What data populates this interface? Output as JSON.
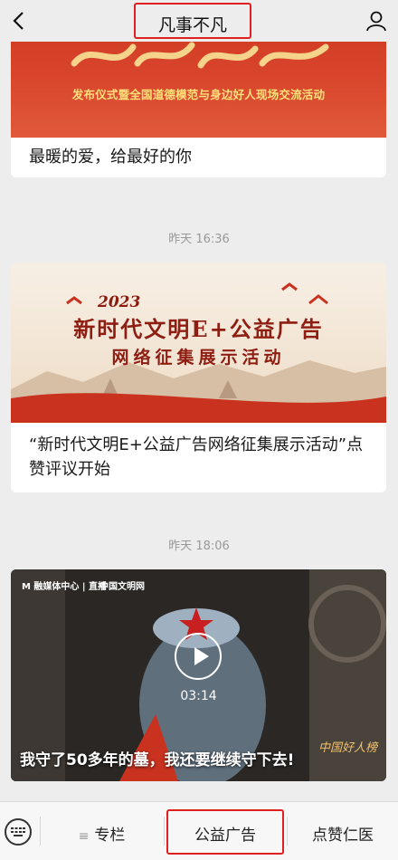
{
  "header": {
    "title": "凡事不凡",
    "back_icon": "chevron-left-icon",
    "profile_icon": "person-icon"
  },
  "feed": {
    "card1": {
      "image_subtitle": "发布仪式暨全国道德模范与身边好人现场交流活动",
      "text": "最暖的爱，给最好的你"
    },
    "time1": "昨天 16:36",
    "card2": {
      "image_year": "2023",
      "image_line1": "新时代文明E+公益广告",
      "image_line2": "网络征集展示活动",
      "text": "“新时代文明E+公益广告网络征集展示活动”点赞评议开始"
    },
    "time2": "昨天 18:06",
    "card3": {
      "duration": "03:14",
      "caption": "我守了50多年的墓，我还要继续守下去!",
      "logo_left": "M 融媒体中心 | 直播",
      "logo_right": "中国文明网",
      "corner_text": "中国好人榜"
    }
  },
  "bottom_menu": {
    "keyboard_icon": "keyboard-icon",
    "item1_icon": "list-icon",
    "item1": "专栏",
    "item2": "公益广告",
    "item3": "点赞仁医"
  },
  "colors": {
    "highlight": "#e02020",
    "background": "#ededed"
  }
}
